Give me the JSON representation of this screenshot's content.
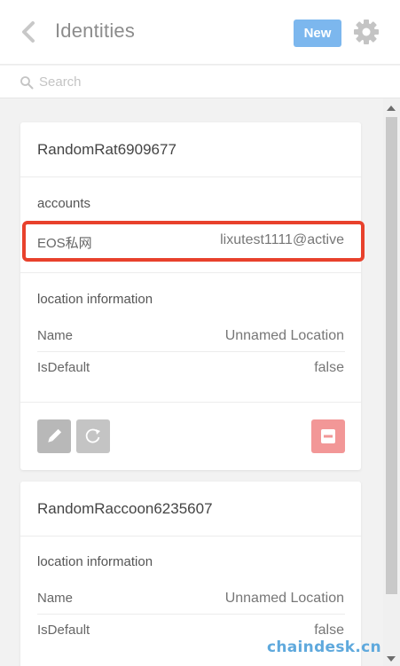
{
  "header": {
    "back_icon": "chevron-left-icon",
    "title": "Identities",
    "new_label": "New",
    "settings_icon": "gear-icon"
  },
  "search": {
    "placeholder": "Search",
    "icon": "search-icon"
  },
  "identities": [
    {
      "name": "RandomRat6909677",
      "accounts_label": "accounts",
      "accounts": [
        {
          "network": "EOS私网",
          "account": "lixutest1111@active"
        }
      ],
      "location_label": "location information",
      "location": [
        {
          "label": "Name",
          "value": "Unnamed Location"
        },
        {
          "label": "IsDefault",
          "value": "false"
        }
      ]
    },
    {
      "name": "RandomRaccoon6235607",
      "location_label": "location information",
      "location": [
        {
          "label": "Name",
          "value": "Unnamed Location"
        },
        {
          "label": "IsDefault",
          "value": "false"
        }
      ]
    }
  ],
  "colors": {
    "accent": "#7cb7ee",
    "highlight": "#e8412c",
    "delete": "#f29797"
  },
  "watermark": "chaindesk.cn"
}
